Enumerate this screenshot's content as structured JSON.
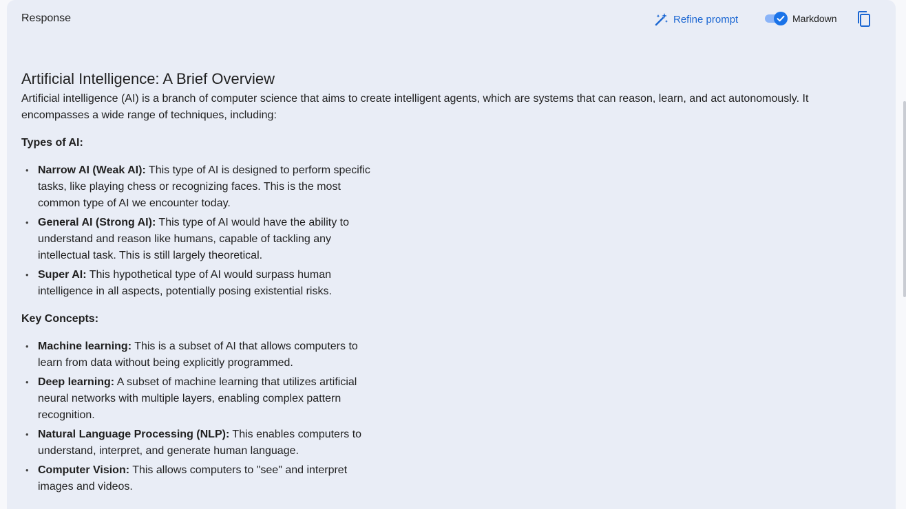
{
  "header": {
    "title": "Response",
    "refine_label": "Refine prompt",
    "markdown_label": "Markdown"
  },
  "colors": {
    "accent": "#1a73e8",
    "link": "#1a66d2",
    "panel_bg": "#e9edf6"
  },
  "icons": {
    "refine": "magic-wand-icon",
    "toggle_check": "check-icon",
    "copy": "copy-icon"
  },
  "article": {
    "title": "Artificial Intelligence: A Brief Overview",
    "intro": "Artificial intelligence (AI) is a branch of computer science that aims to create intelligent agents, which are systems that can reason, learn, and act autonomously. It encompasses a wide range of techniques, including:",
    "sections": [
      {
        "heading": "Types of AI:",
        "items": [
          {
            "term": "Narrow AI (Weak AI):",
            "text": " This type of AI is designed to perform specific tasks, like playing chess or recognizing faces. This is the most common type of AI we encounter today."
          },
          {
            "term": "General AI (Strong AI):",
            "text": " This type of AI would have the ability to understand and reason like humans, capable of tackling any intellectual task. This is still largely theoretical."
          },
          {
            "term": "Super AI:",
            "text": " This hypothetical type of AI would surpass human intelligence in all aspects, potentially posing existential risks."
          }
        ]
      },
      {
        "heading": "Key Concepts:",
        "items": [
          {
            "term": "Machine learning:",
            "text": " This is a subset of AI that allows computers to learn from data without being explicitly programmed."
          },
          {
            "term": "Deep learning:",
            "text": " A subset of machine learning that utilizes artificial neural networks with multiple layers, enabling complex pattern recognition."
          },
          {
            "term": "Natural Language Processing (NLP):",
            "text": " This enables computers to understand, interpret, and generate human language."
          },
          {
            "term": "Computer Vision:",
            "text": " This allows computers to \"see\" and interpret images and videos."
          }
        ]
      }
    ]
  }
}
